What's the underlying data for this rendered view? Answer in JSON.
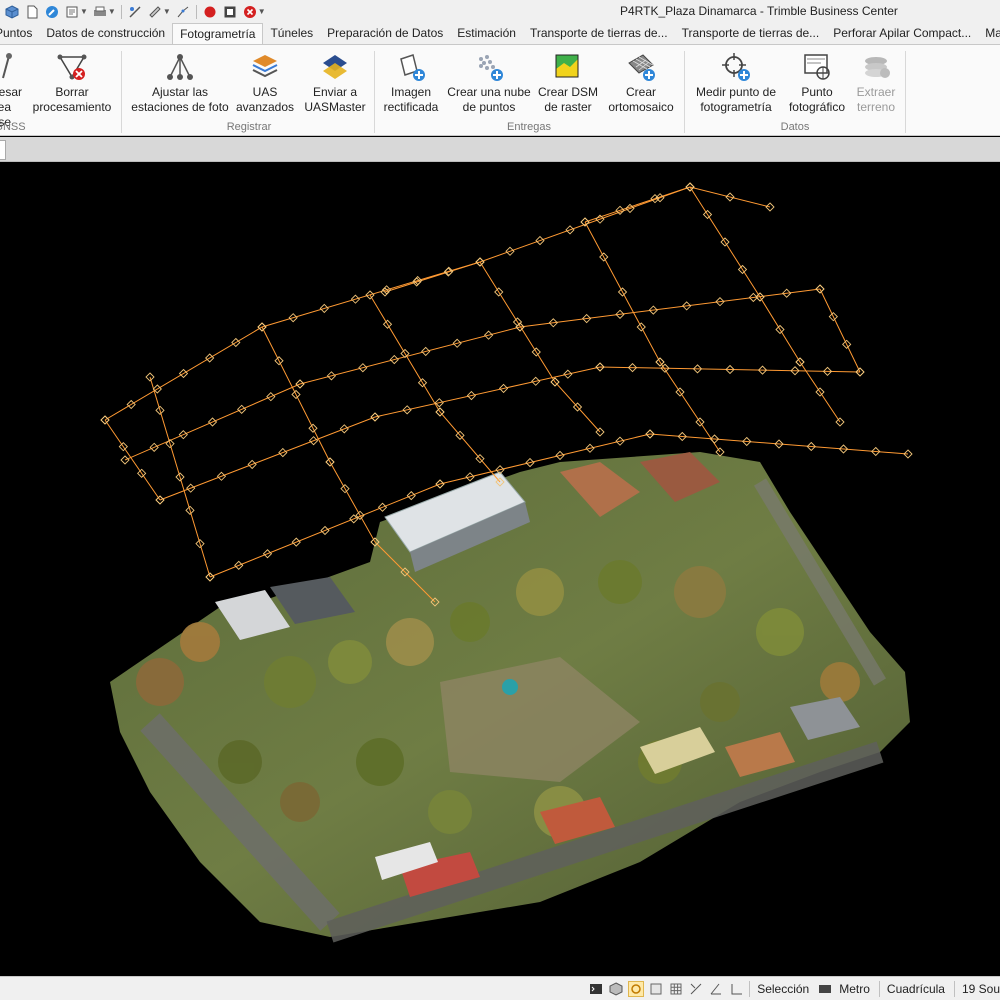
{
  "window": {
    "title": "P4RTK_Plaza Dinamarca - Trimble Business Center"
  },
  "quick_access": [
    "cube-icon",
    "new-doc-icon",
    "compass-icon",
    "file-icon",
    "print-icon",
    "survey-tools-icon",
    "measure-icon",
    "line-tools-icon",
    "record-icon",
    "stop-icon",
    "close-red-icon"
  ],
  "tabs": [
    {
      "label": "Puntos"
    },
    {
      "label": "Datos de construcción"
    },
    {
      "label": "Fotogrametría",
      "active": true
    },
    {
      "label": "Túneles"
    },
    {
      "label": "Preparación de Datos"
    },
    {
      "label": "Estimación"
    },
    {
      "label": "Transporte de tierras de..."
    },
    {
      "label": "Transporte de tierras de..."
    },
    {
      "label": "Perforar Apilar Compact..."
    },
    {
      "label": "Macros"
    }
  ],
  "ribbon": {
    "buttons": [
      {
        "line1": "Procesar",
        "line2": "línea base",
        "icon": "baseline-icon",
        "disabled": false
      },
      {
        "line1": "Borrar",
        "line2": "procesamiento",
        "icon": "delete-processing-icon",
        "disabled": false
      },
      {
        "line1": "Ajustar las",
        "line2": "estaciones de foto",
        "icon": "adjust-stations-icon",
        "disabled": false
      },
      {
        "line1": "UAS",
        "line2": "avanzados",
        "icon": "uas-advanced-icon",
        "disabled": false
      },
      {
        "line1": "Enviar a",
        "line2": "UASMaster",
        "icon": "send-uasmaster-icon",
        "disabled": false
      },
      {
        "line1": "Imagen",
        "line2": "rectificada",
        "icon": "rectified-image-icon",
        "disabled": false
      },
      {
        "line1": "Crear una nube",
        "line2": "de puntos",
        "icon": "point-cloud-icon",
        "disabled": false
      },
      {
        "line1": "Crear DSM",
        "line2": "de raster",
        "icon": "raster-dsm-icon",
        "disabled": false
      },
      {
        "line1": "Crear",
        "line2": "ortomosaico",
        "icon": "orthomosaic-icon",
        "disabled": false
      },
      {
        "line1": "Medir punto de",
        "line2": "fotogrametría",
        "icon": "measure-point-icon",
        "disabled": false
      },
      {
        "line1": "Punto",
        "line2": "fotográfico",
        "icon": "photo-point-icon",
        "disabled": false
      },
      {
        "line1": "Extraer",
        "line2": "terreno",
        "icon": "extract-terrain-icon",
        "disabled": true
      }
    ],
    "groups": [
      {
        "label": "GNSS"
      },
      {
        "label": "Registrar"
      },
      {
        "label": "Entregas"
      },
      {
        "label": "Datos"
      }
    ]
  },
  "status_bar": {
    "icons": [
      "command-icon",
      "cube-icon",
      "snap-icon",
      "ortho-icon",
      "grid-icon",
      "coord-icon",
      "angle-icon"
    ],
    "selection_label": "Selección",
    "units_label": "Metro",
    "grid_label": "Cuadrícula",
    "count_label": "19 Sou"
  },
  "colors": {
    "flight_line": "#ff9a33",
    "station_marker": "#f1c57a",
    "ribbon_bg": "#fafafa",
    "chrome_bg": "#f0f0f0"
  }
}
